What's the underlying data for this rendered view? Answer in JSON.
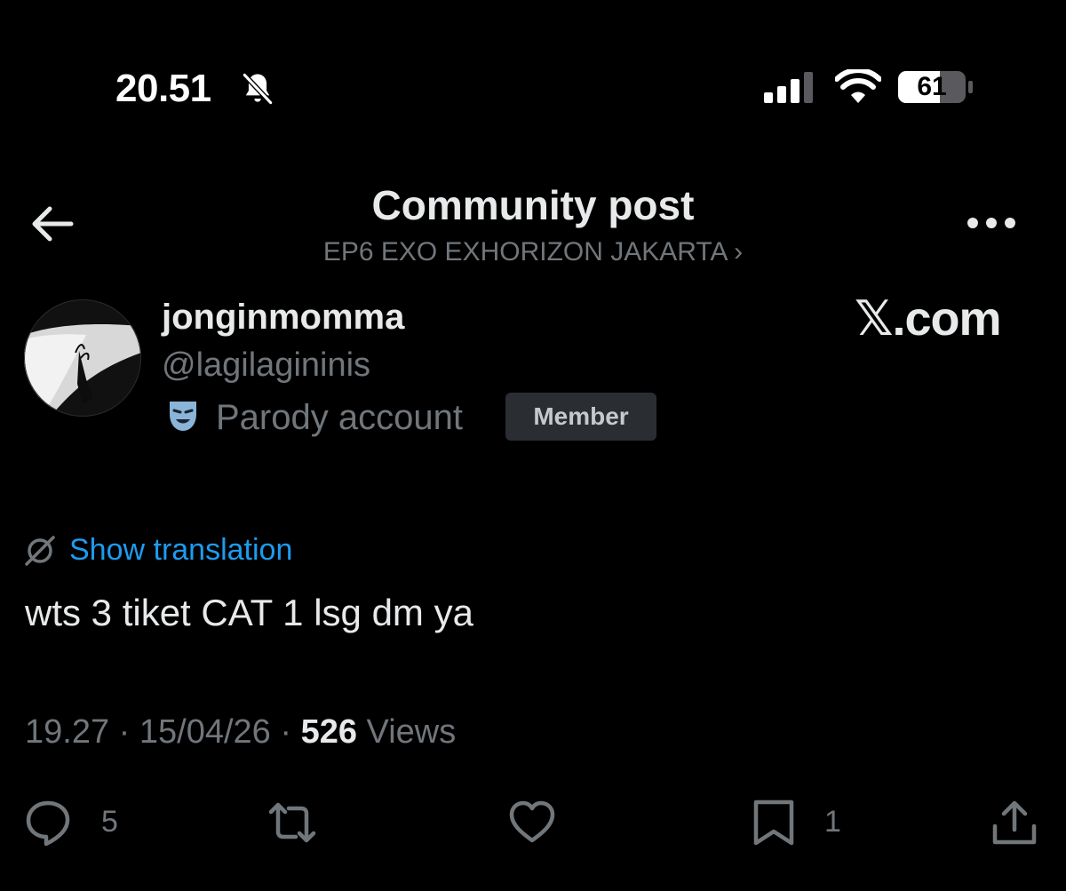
{
  "status_bar": {
    "time": "20.51",
    "battery": "61",
    "icons": [
      "bell-slash-icon",
      "signal-icon",
      "wifi-icon",
      "battery-icon"
    ]
  },
  "header": {
    "title": "Community post",
    "community": "EP6 EXO EXHORIZON JAKARTA ›",
    "icons": [
      "back-arrow-icon",
      "more-icon"
    ]
  },
  "author": {
    "display_name": "jonginmomma",
    "handle": "@lagilagininis",
    "label": "Parody account",
    "badge": "Member",
    "icons": [
      "mask-icon"
    ]
  },
  "watermark": "𝕏.com",
  "post": {
    "translation_label": "Show translation",
    "text": "wts 3 tiket CAT 1 lsg dm ya",
    "time": "19.27",
    "date": "15/04/26",
    "views_count": "526",
    "views_label": "Views"
  },
  "actions": {
    "reply_count": "5",
    "bookmark_count": "1",
    "icons": [
      "reply-icon",
      "repost-icon",
      "like-icon",
      "bookmark-icon",
      "share-icon"
    ]
  },
  "colors": {
    "background": "#000000",
    "text_primary": "#e7e9ea",
    "text_secondary": "#71767b",
    "accent": "#1d9bf0"
  }
}
